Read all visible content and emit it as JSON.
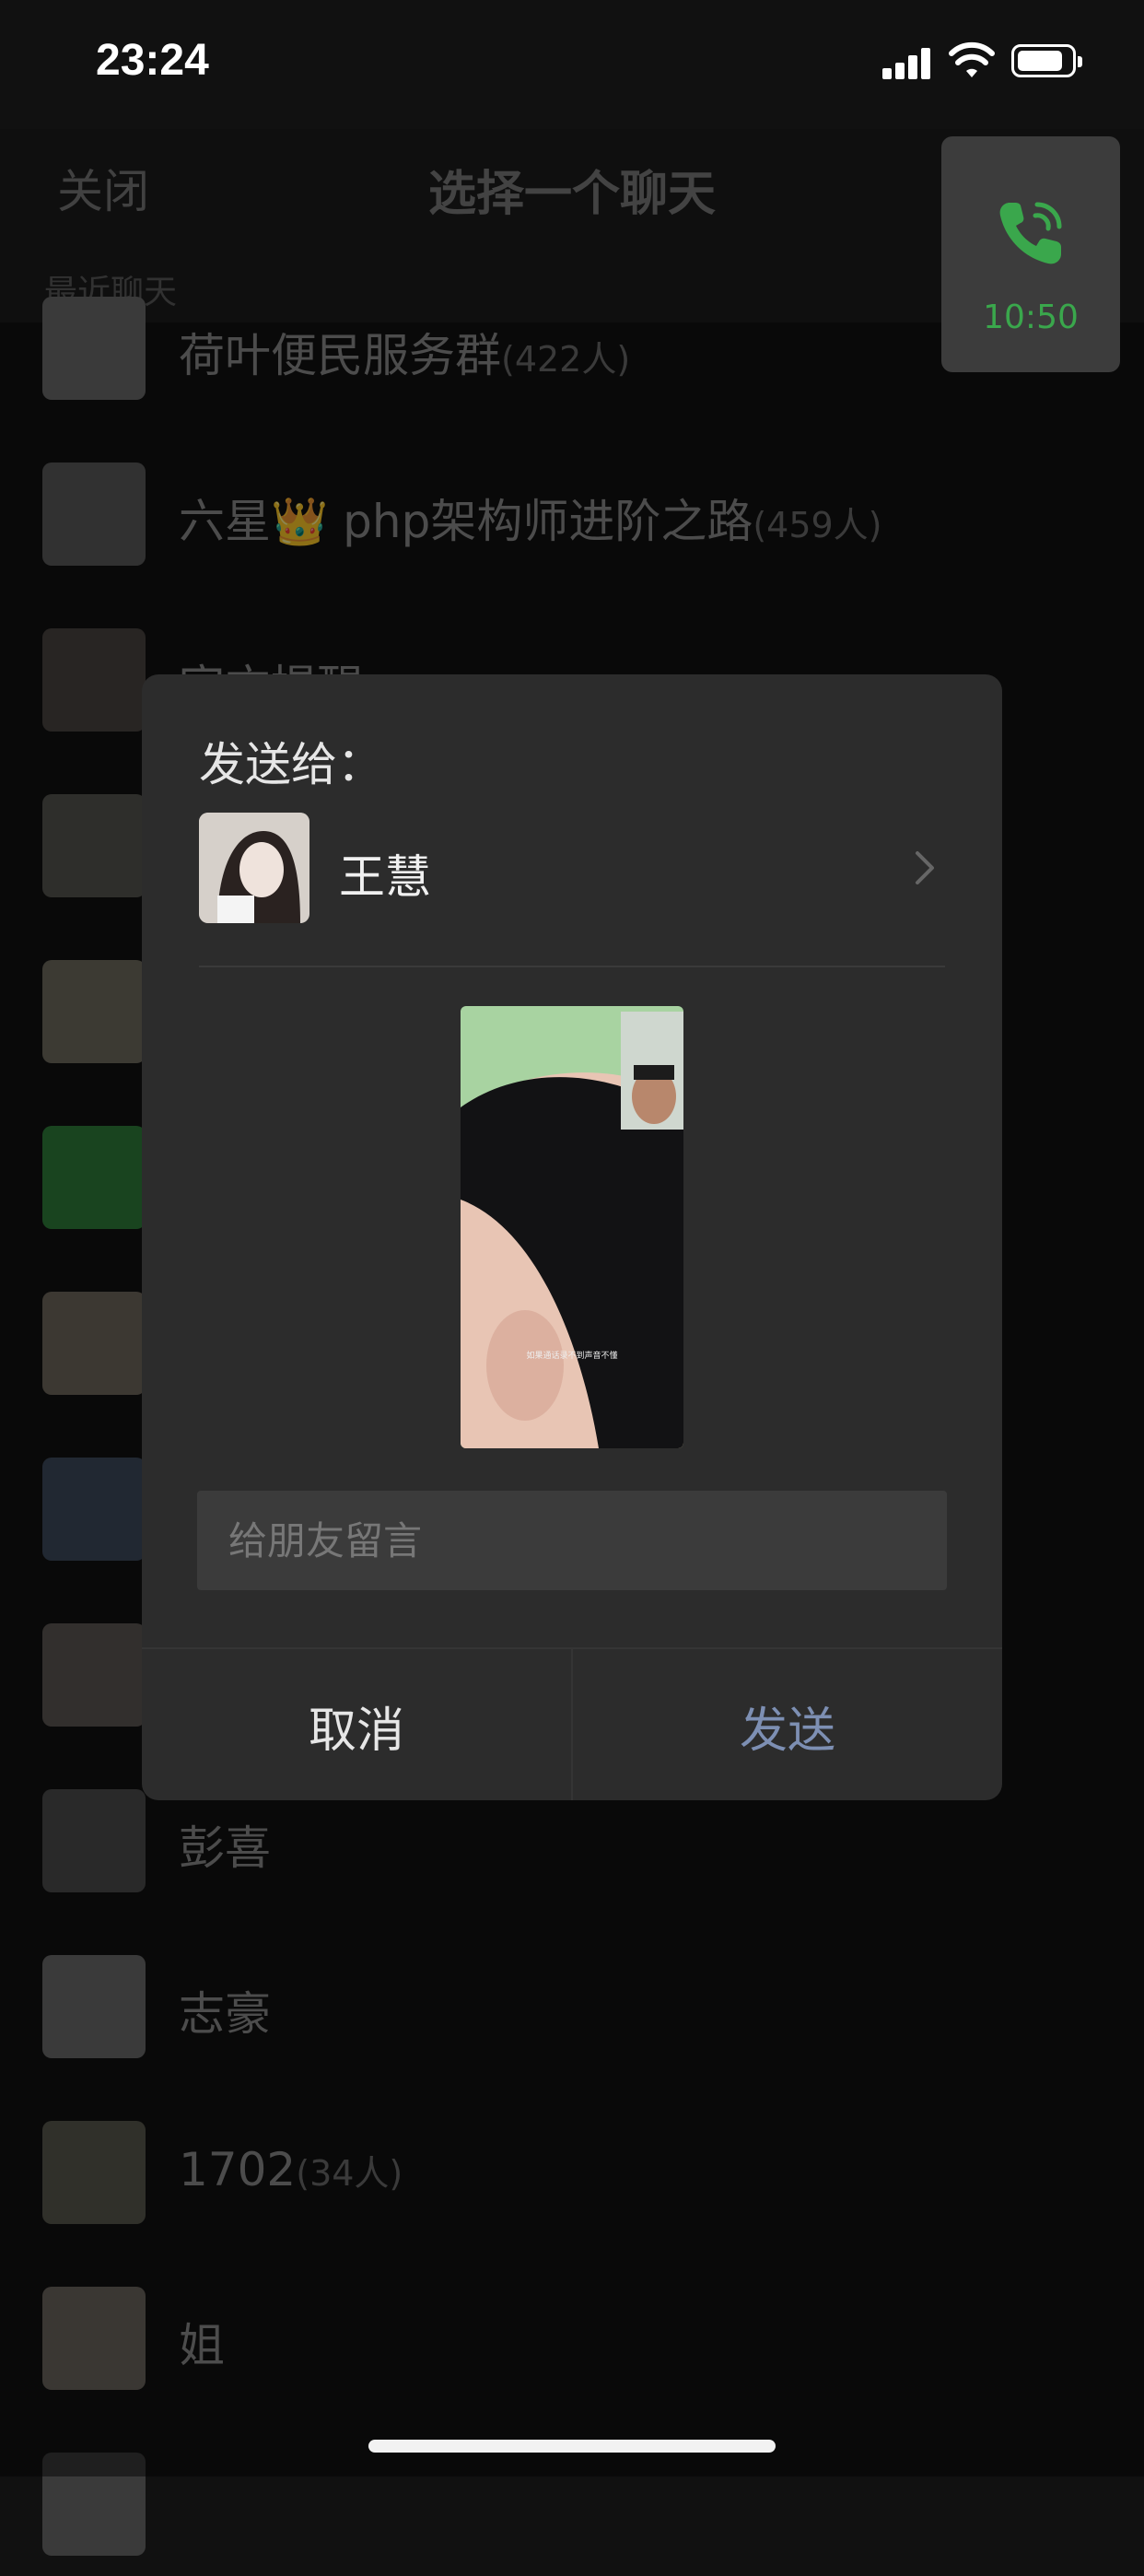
{
  "status_bar": {
    "time": "23:24"
  },
  "header": {
    "close_label": "关闭",
    "title": "选择一个聊天",
    "section_label": "最近聊天"
  },
  "call": {
    "duration": "10:50"
  },
  "chats": [
    {
      "name": "荷叶便民服务群",
      "count": "(422人)"
    },
    {
      "name": "六星👑 php架构师进阶之路",
      "count": "(459人)"
    },
    {
      "name": "官方提醒",
      "count": ""
    },
    {
      "name": "彭喜",
      "count": ""
    },
    {
      "name": "志豪",
      "count": ""
    },
    {
      "name": "1702",
      "count": "(34人)"
    },
    {
      "name": "姐",
      "count": ""
    }
  ],
  "dialog": {
    "title": "发送给：",
    "recipient": "王慧",
    "preview_caption": "如果通话录不到声音不懂",
    "message_placeholder": "给朋友留言",
    "cancel_label": "取消",
    "send_label": "发送"
  },
  "colors": {
    "accent_green": "#3aa74c",
    "send_blue": "#7d8fb3"
  }
}
